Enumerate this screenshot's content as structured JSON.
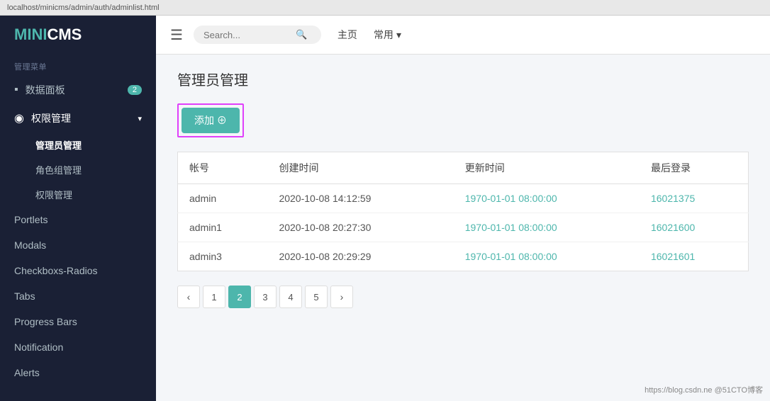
{
  "browser": {
    "url": "localhost/minicms/admin/auth/adminlist.html"
  },
  "sidebar": {
    "logo": "MINICMS",
    "section_label": "管理菜单",
    "items": [
      {
        "id": "dashboard",
        "label": "数据面板",
        "icon": "▪",
        "badge": "2",
        "active": false
      },
      {
        "id": "permission",
        "label": "权限管理",
        "icon": "◉",
        "active": true,
        "has_chevron": true
      },
      {
        "id": "admin-manage",
        "label": "管理员管理",
        "sub": true,
        "active": true
      },
      {
        "id": "role-manage",
        "label": "角色组管理",
        "sub": true,
        "active": false
      },
      {
        "id": "perm-manage",
        "label": "权限管理",
        "sub": true,
        "active": false
      },
      {
        "id": "portlets",
        "label": "Portlets",
        "active": false
      },
      {
        "id": "modals",
        "label": "Modals",
        "active": false
      },
      {
        "id": "checkboxs",
        "label": "Checkboxs-Radios",
        "active": false
      },
      {
        "id": "tabs",
        "label": "Tabs",
        "active": false
      },
      {
        "id": "progress-bars",
        "label": "Progress Bars",
        "active": false
      },
      {
        "id": "notification",
        "label": "Notification",
        "active": false
      },
      {
        "id": "alerts",
        "label": "Alerts",
        "active": false
      }
    ]
  },
  "navbar": {
    "home_label": "主页",
    "common_label": "常用",
    "search_placeholder": "Search..."
  },
  "page": {
    "title": "管理员管理",
    "add_button": "添加 ⊕",
    "table": {
      "columns": [
        "帐号",
        "创建时间",
        "更新时间",
        "最后登录"
      ],
      "rows": [
        {
          "account": "admin",
          "created": "2020-10-08 14:12:59",
          "updated": "1970-01-01 08:00:00",
          "last_login": "16021375"
        },
        {
          "account": "admin1",
          "created": "2020-10-08 20:27:30",
          "updated": "1970-01-01 08:00:00",
          "last_login": "16021600"
        },
        {
          "account": "admin3",
          "created": "2020-10-08 20:29:29",
          "updated": "1970-01-01 08:00:00",
          "last_login": "16021601"
        }
      ]
    },
    "pagination": {
      "prev": "‹",
      "next": "›",
      "pages": [
        "1",
        "2",
        "3",
        "4",
        "5"
      ],
      "active_page": "2"
    }
  },
  "watermark": "https://blog.csdn.ne @51CTO博客"
}
